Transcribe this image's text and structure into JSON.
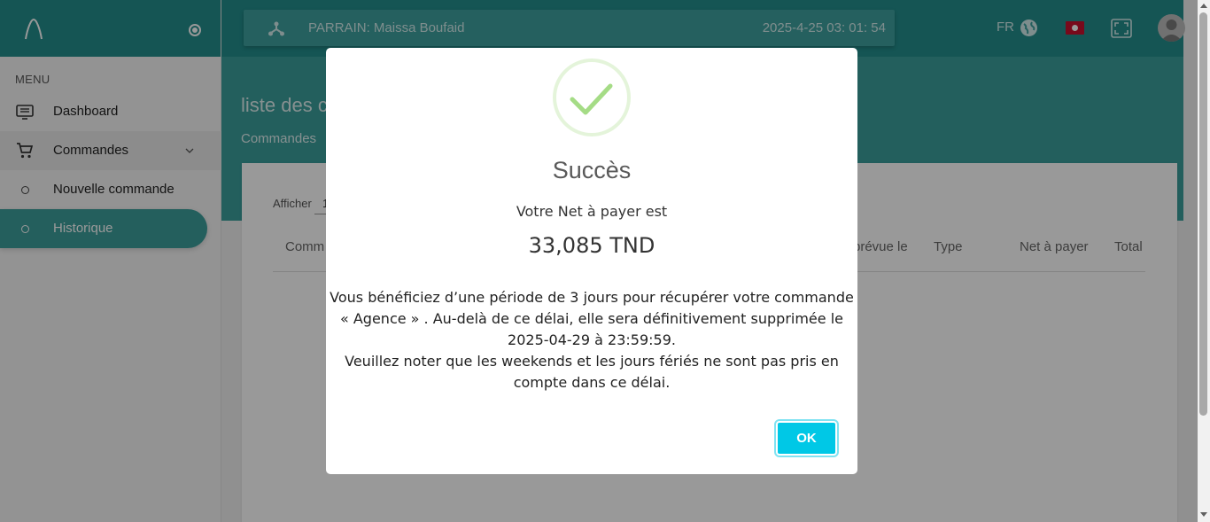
{
  "sidebar": {
    "menu_title": "MENU",
    "items": [
      {
        "label": "Dashboard",
        "icon": "dashboard-icon"
      },
      {
        "label": "Commandes",
        "icon": "cart-icon"
      },
      {
        "label": "Nouvelle commande",
        "icon": "circle-icon"
      },
      {
        "label": "Historique",
        "icon": "circle-icon"
      }
    ]
  },
  "header": {
    "parrain": "PARRAIN: Maissa Boufaid",
    "datetime": "2025-4-25 03: 01: 54",
    "language": "FR"
  },
  "main": {
    "title": "liste des c",
    "breadcrumb": "Commandes",
    "show_label": "Afficher",
    "show_value": "1",
    "columns": [
      "Comm",
      "prévue le",
      "Type",
      "Net à payer",
      "Total"
    ]
  },
  "modal": {
    "title": "Succès",
    "subtitle": "Votre Net à payer est",
    "amount": "33,085 TND",
    "message_line1": "Vous bénéficiez d’une période de 3 jours pour récupérer votre commande « Agence » . Au-delà de ce délai, elle sera définitivement supprimée le 2025-04-29 à 23:59:59.",
    "message_line2": "Veuillez noter que les weekends et les jours fériés ne sont pas pris en compte dans ce délai.",
    "ok_label": "OK"
  },
  "colors": {
    "primary": "#238e8c",
    "active": "#3d9e9c",
    "ok_button": "#00c8e6",
    "success": "#a5dc86"
  }
}
